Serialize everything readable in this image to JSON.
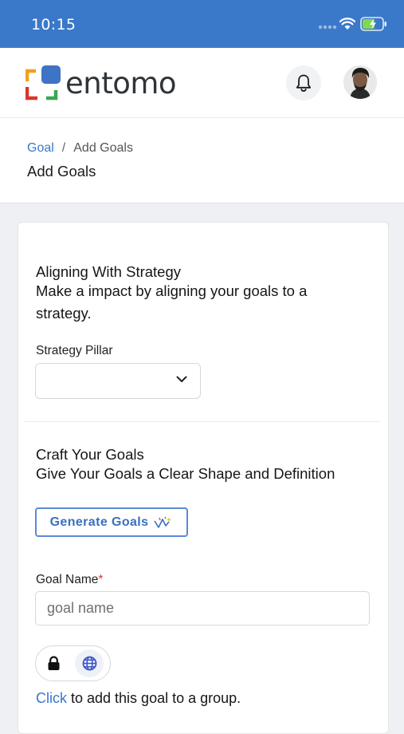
{
  "status": {
    "time": "10:15"
  },
  "header": {
    "logo_text": "entomo",
    "brand_colors": {
      "orange": "#f0a020",
      "blue": "#3f73c5",
      "red": "#d9362b",
      "green": "#3aa655"
    }
  },
  "breadcrumb": {
    "root": "Goal",
    "separator": "/",
    "current": "Add Goals"
  },
  "page": {
    "title": "Add Goals"
  },
  "strategy": {
    "heading": "Aligning With Strategy",
    "subheading": "Make a impact by aligning your goals to a strategy.",
    "pillar_label": "Strategy Pillar",
    "pillar_value": ""
  },
  "craft": {
    "heading": "Craft Your Goals",
    "subheading": "Give Your Goals a Clear Shape and Definition",
    "generate_label": "Generate Goals",
    "goal_name_label": "Goal Name",
    "required_mark": "*",
    "goal_name_placeholder": "goal name",
    "group_link": "Click",
    "group_text": " to add this goal to a group."
  },
  "icons": {
    "bell": "bell-icon",
    "chevron": "chevron-down-icon",
    "lock": "lock-icon",
    "globe": "globe-icon",
    "sparkle": "sparkle-icon"
  },
  "accent": "#3a78c9"
}
